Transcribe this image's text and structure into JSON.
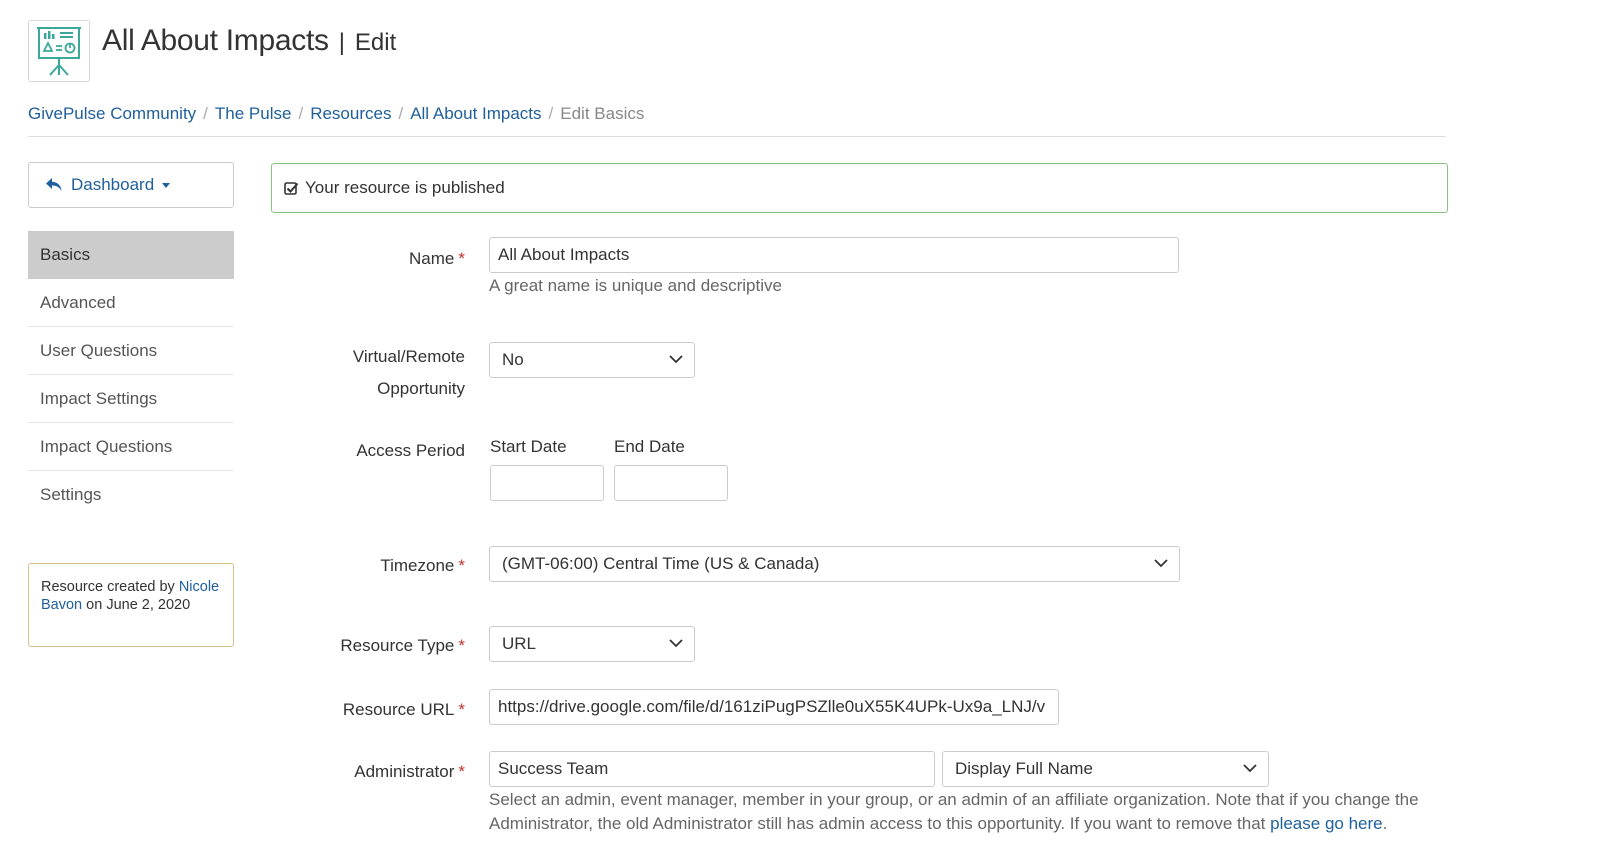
{
  "header": {
    "title": "All About Impacts",
    "separator": "|",
    "subtitle": "Edit"
  },
  "breadcrumb": [
    {
      "label": "GivePulse Community",
      "link": true
    },
    {
      "label": "The Pulse",
      "link": true
    },
    {
      "label": "Resources",
      "link": true
    },
    {
      "label": "All About Impacts",
      "link": true
    },
    {
      "label": "Edit Basics",
      "link": false
    }
  ],
  "breadcrumb_sep": "/",
  "sidebar": {
    "dashboard_label": "Dashboard",
    "items": [
      {
        "label": "Basics",
        "active": true
      },
      {
        "label": "Advanced"
      },
      {
        "label": "User Questions"
      },
      {
        "label": "Impact Settings"
      },
      {
        "label": "Impact Questions"
      },
      {
        "label": "Settings"
      }
    ],
    "created": {
      "prefix": "Resource created by",
      "author": "Nicole Bavon",
      "suffix": "on June 2, 2020"
    }
  },
  "alert": {
    "text": "Your resource is published"
  },
  "form": {
    "name": {
      "label": "Name",
      "value": "All About Impacts",
      "help": "A great name is unique and descriptive"
    },
    "virtual": {
      "label_line1": "Virtual/Remote",
      "label_line2": "Opportunity",
      "value": "No"
    },
    "access": {
      "label": "Access Period",
      "start_label": "Start Date",
      "end_label": "End Date",
      "start_value": "",
      "end_value": ""
    },
    "timezone": {
      "label": "Timezone",
      "value": "(GMT-06:00) Central Time (US & Canada)"
    },
    "resource_type": {
      "label": "Resource Type",
      "value": "URL"
    },
    "resource_url": {
      "label": "Resource URL",
      "value": "https://drive.google.com/file/d/161ziPugPSZlle0uX55K4UPk-Ux9a_LNJ/v"
    },
    "administrator": {
      "label": "Administrator",
      "value": "Success Team",
      "display_value": "Display Full Name",
      "help_line1": "Select an admin, event manager, member in your group, or an admin of an affiliate organization. Note that if you change the",
      "help_line2": "Administrator, the old Administrator still has admin access to this opportunity. If you want to remove that",
      "help_link": "please go here",
      "help_end": "."
    },
    "required_mark": "*"
  },
  "colors": {
    "link": "#1f5f9b",
    "required": "#c9302c",
    "alert_border": "#8bbf84",
    "active_nav": "#cccccc",
    "logo_teal": "#3aa99b"
  }
}
